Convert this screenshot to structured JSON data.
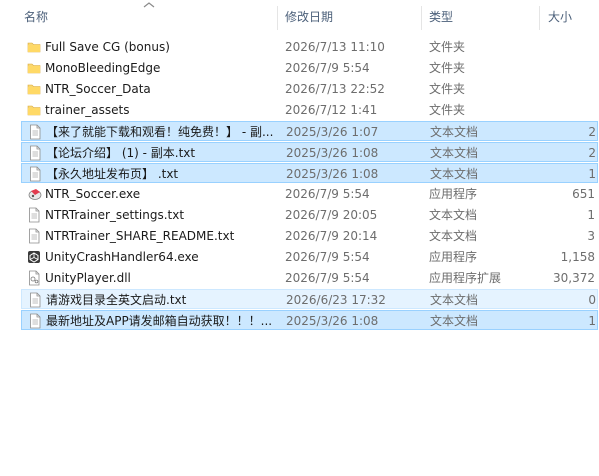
{
  "columns": {
    "name": "名称",
    "date": "修改日期",
    "type": "类型",
    "size": "大小"
  },
  "sort_icon": "chevron-up-icon",
  "files": [
    {
      "name": "Full Save CG (bonus)",
      "date": "2026/7/13 11:10",
      "type": "文件夹",
      "size": "",
      "icon": "folder-icon",
      "selected": "none"
    },
    {
      "name": "MonoBleedingEdge",
      "date": "2026/7/9 5:54",
      "type": "文件夹",
      "size": "",
      "icon": "folder-icon",
      "selected": "none"
    },
    {
      "name": "NTR_Soccer_Data",
      "date": "2026/7/13 22:52",
      "type": "文件夹",
      "size": "",
      "icon": "folder-icon",
      "selected": "none"
    },
    {
      "name": "trainer_assets",
      "date": "2026/7/12 1:41",
      "type": "文件夹",
      "size": "",
      "icon": "folder-icon",
      "selected": "none"
    },
    {
      "name": "【来了就能下载和观看！纯免费！】 - 副...",
      "date": "2025/3/26 1:07",
      "type": "文本文档",
      "size": "2",
      "icon": "text-file-icon",
      "selected": "strong"
    },
    {
      "name": "【论坛介绍】 (1) - 副本.txt",
      "date": "2025/3/26 1:08",
      "type": "文本文档",
      "size": "2",
      "icon": "text-file-icon",
      "selected": "strong"
    },
    {
      "name": "【永久地址发布页】 .txt",
      "date": "2025/3/26 1:08",
      "type": "文本文档",
      "size": "1",
      "icon": "text-file-icon",
      "selected": "strong"
    },
    {
      "name": "NTR_Soccer.exe",
      "date": "2026/7/9 5:54",
      "type": "应用程序",
      "size": "651",
      "icon": "app-exe-icon",
      "selected": "none"
    },
    {
      "name": "NTRTrainer_settings.txt",
      "date": "2026/7/9 20:05",
      "type": "文本文档",
      "size": "1",
      "icon": "text-file-icon",
      "selected": "none"
    },
    {
      "name": "NTRTrainer_SHARE_README.txt",
      "date": "2026/7/9 20:14",
      "type": "文本文档",
      "size": "3",
      "icon": "text-file-icon",
      "selected": "none"
    },
    {
      "name": "UnityCrashHandler64.exe",
      "date": "2026/7/9 5:54",
      "type": "应用程序",
      "size": "1,158",
      "icon": "unity-icon",
      "selected": "none"
    },
    {
      "name": "UnityPlayer.dll",
      "date": "2026/7/9 5:54",
      "type": "应用程序扩展",
      "size": "30,372",
      "icon": "dll-file-icon",
      "selected": "none"
    },
    {
      "name": "请游戏目录全英文启动.txt",
      "date": "2026/6/23 17:32",
      "type": "文本文档",
      "size": "0",
      "icon": "text-file-icon",
      "selected": "soft"
    },
    {
      "name": "最新地址及APP请发邮箱自动获取！！！...",
      "date": "2025/3/26 1:08",
      "type": "文本文档",
      "size": "1",
      "icon": "text-file-icon",
      "selected": "strong"
    }
  ]
}
